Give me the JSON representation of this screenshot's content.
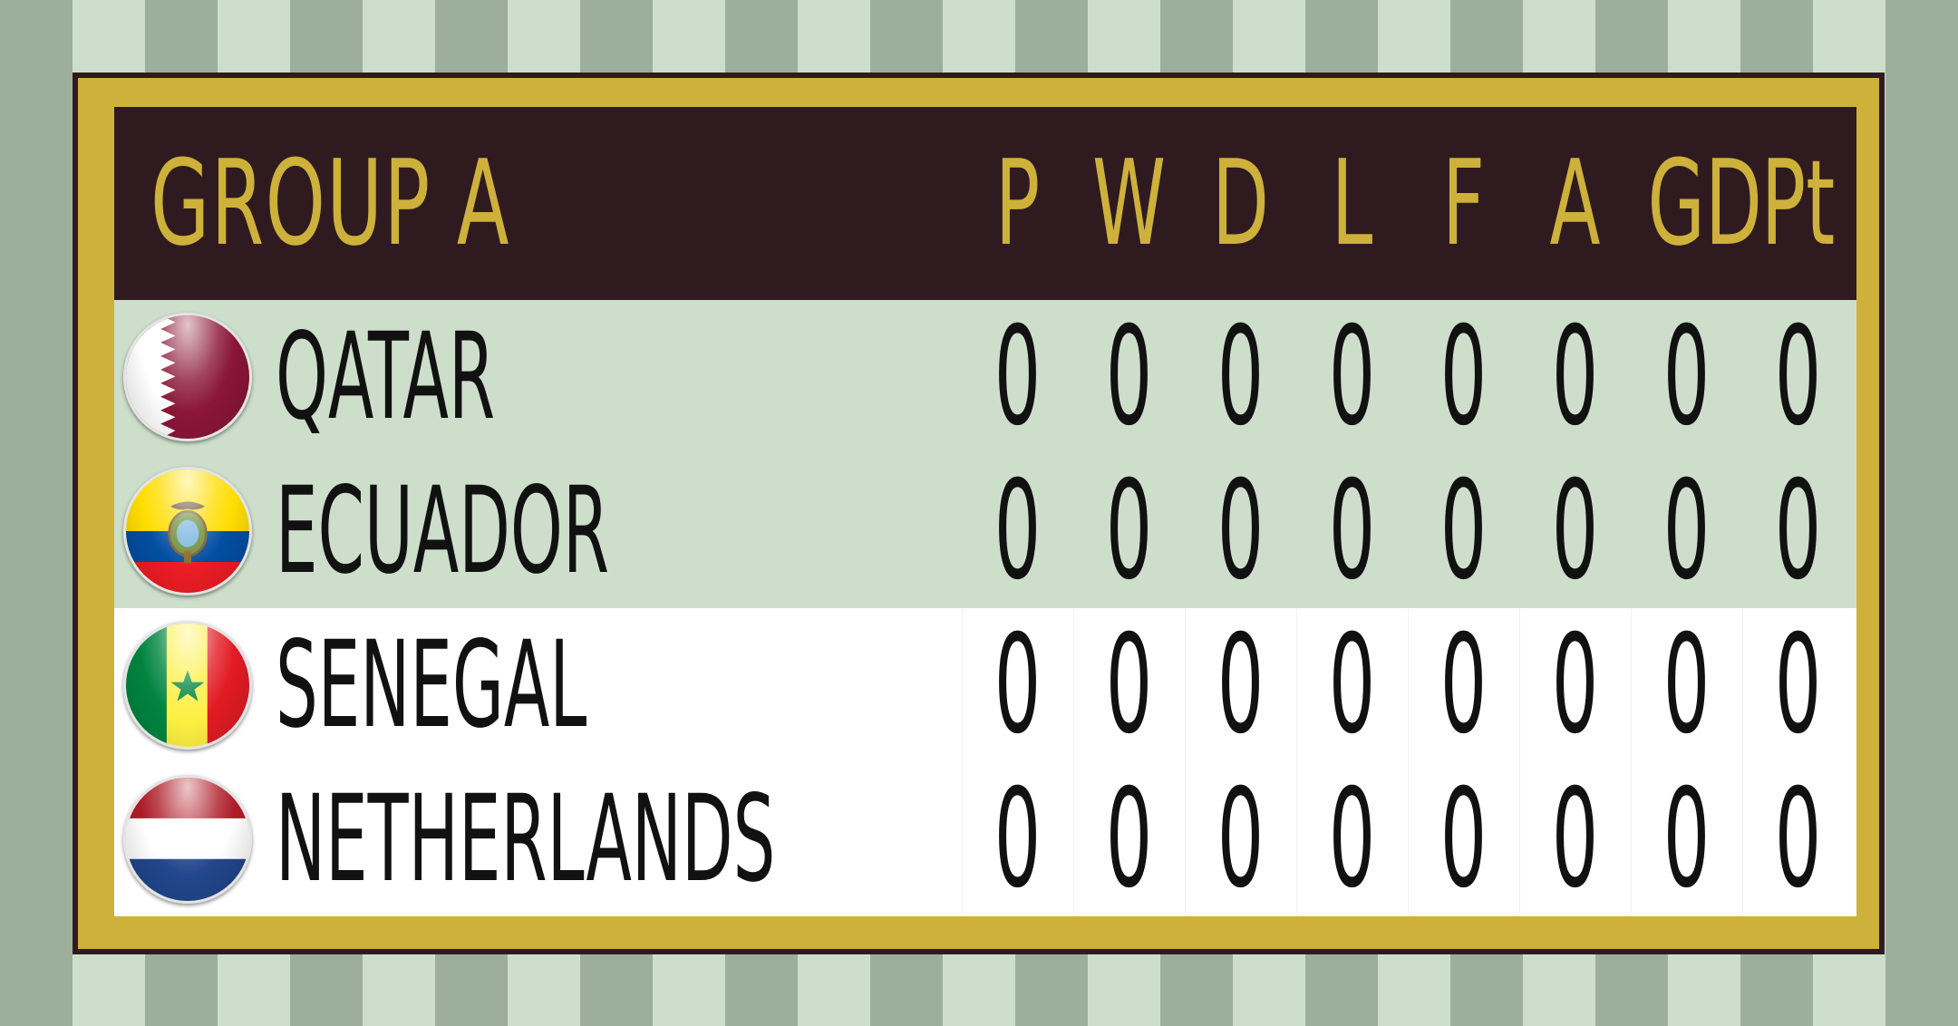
{
  "group_title": "GROUP A",
  "columns": [
    "P",
    "W",
    "D",
    "L",
    "F",
    "A",
    "GD",
    "Pt"
  ],
  "teams": [
    {
      "name": "QATAR",
      "flag": "qatar-flag",
      "stats": [
        "0",
        "0",
        "0",
        "0",
        "0",
        "0",
        "0",
        "0"
      ]
    },
    {
      "name": "ECUADOR",
      "flag": "ecuador-flag",
      "stats": [
        "0",
        "0",
        "0",
        "0",
        "0",
        "0",
        "0",
        "0"
      ]
    },
    {
      "name": "SENEGAL",
      "flag": "senegal-flag",
      "stats": [
        "0",
        "0",
        "0",
        "0",
        "0",
        "0",
        "0",
        "0"
      ]
    },
    {
      "name": "NETHERLANDS",
      "flag": "netherlands-flag",
      "stats": [
        "0",
        "0",
        "0",
        "0",
        "0",
        "0",
        "0",
        "0"
      ]
    }
  ],
  "colors": {
    "board": "#2f1b1f",
    "gold": "#cdb13b",
    "qualified_row": "#cddfcb",
    "other_row": "#ffffff",
    "stripe_dark": "#9caf9b",
    "stripe_light": "#cddfcb"
  }
}
